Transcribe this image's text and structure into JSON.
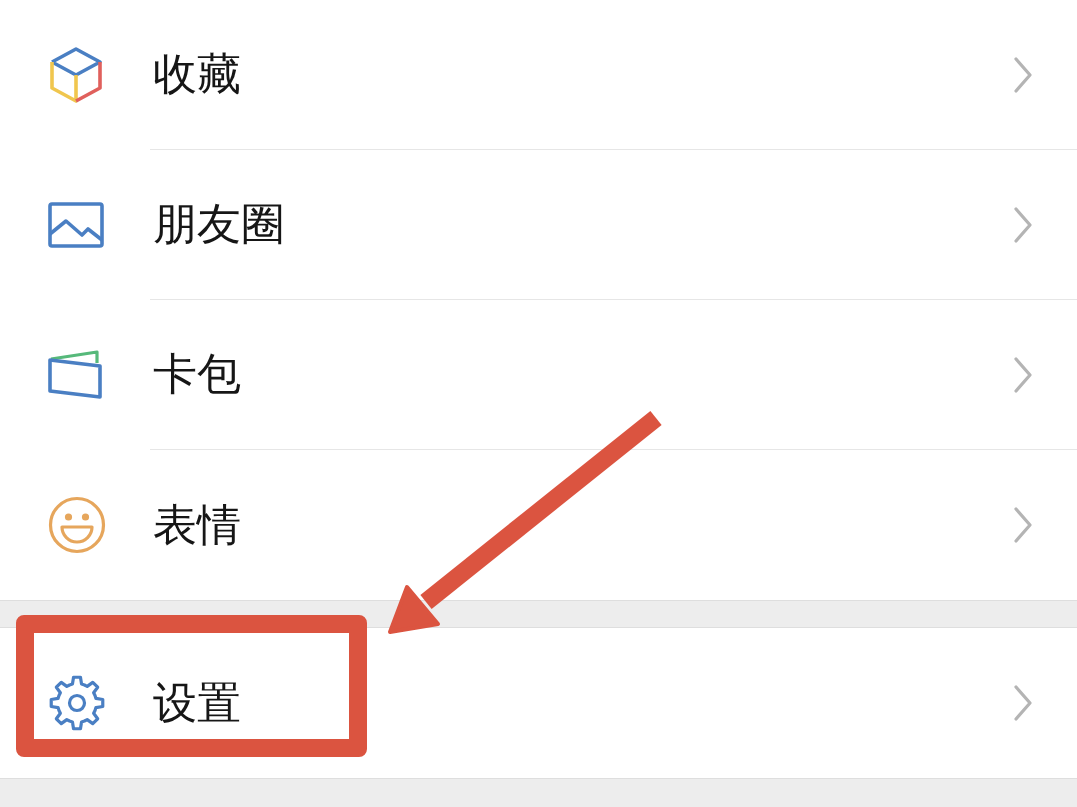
{
  "menu_groups": [
    {
      "items": [
        {
          "label": "收藏",
          "highlighted": false
        },
        {
          "label": "朋友圈",
          "highlighted": false
        },
        {
          "label": "卡包",
          "highlighted": false
        },
        {
          "label": "表情",
          "highlighted": false
        }
      ]
    },
    {
      "items": [
        {
          "label": "设置",
          "highlighted": true
        }
      ]
    }
  ]
}
